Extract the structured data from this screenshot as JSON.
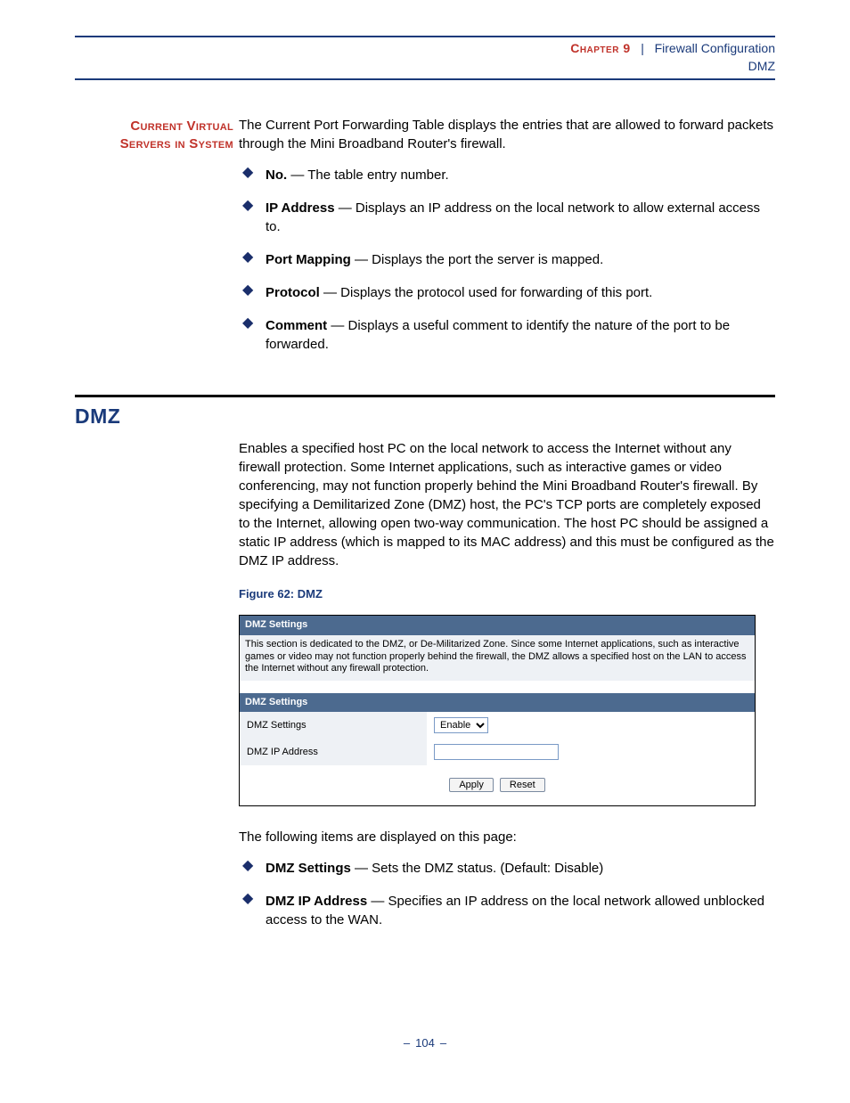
{
  "header": {
    "chapter_label": "Chapter 9",
    "sep": "|",
    "chapter_title": "Firewall Configuration",
    "page_topic": "DMZ"
  },
  "section1": {
    "margin_label_line1": "Current Virtual",
    "margin_label_line2": "Servers in System",
    "intro": "The Current Port Forwarding Table displays the entries that are allowed to forward packets through the Mini Broadband Router's firewall.",
    "bullets": [
      {
        "term": "No.",
        "desc": " — The table entry number."
      },
      {
        "term": "IP Address",
        "desc": " — Displays an IP address on the local network to allow external access to."
      },
      {
        "term": "Port Mapping",
        "desc": " — Displays the port the server is mapped."
      },
      {
        "term": "Protocol",
        "desc": " — Displays the protocol used for forwarding of this port."
      },
      {
        "term": "Comment",
        "desc": " — Displays a useful comment to identify the nature of the port to be forwarded."
      }
    ]
  },
  "section2": {
    "title": "DMZ",
    "intro": "Enables a specified host PC on the local network to access the Internet without any firewall protection. Some Internet applications, such as interactive games or video conferencing, may not function properly behind the Mini Broadband Router's firewall. By specifying a Demilitarized Zone (DMZ) host, the PC's TCP ports are completely exposed to the Internet, allowing open two-way communication. The host PC should be assigned a static IP address (which is mapped to its MAC address) and this must be configured as the DMZ IP address.",
    "figure_caption": "Figure 62:  DMZ",
    "shot": {
      "bar1": "DMZ Settings",
      "desc": "This section is dedicated to the DMZ, or De-Militarized Zone. Since some Internet applications, such as interactive games or video may not function properly behind the firewall, the DMZ allows a specified host on the LAN to access the Internet without any firewall protection.",
      "bar2": "DMZ Settings",
      "row1_label": "DMZ Settings",
      "row1_select_value": "Enable",
      "row2_label": "DMZ IP Address",
      "row2_input_value": "",
      "btn_apply": "Apply",
      "btn_reset": "Reset"
    },
    "after_shot": "The following items are displayed on this page:",
    "bullets": [
      {
        "term": "DMZ Settings",
        "desc": " — Sets the DMZ status. (Default: Disable)"
      },
      {
        "term": "DMZ IP Address",
        "desc": " — Specifies an IP address on the local network allowed unblocked access to the WAN."
      }
    ]
  },
  "footer": {
    "page_number": "104"
  }
}
